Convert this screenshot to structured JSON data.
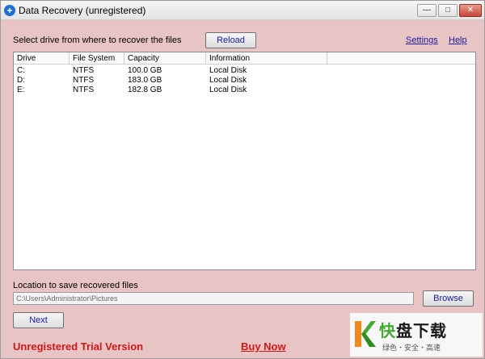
{
  "window": {
    "title": "Data Recovery (unregistered)",
    "controls": {
      "minimize": "—",
      "maximize": "□",
      "close": "✕"
    }
  },
  "toolbar": {
    "prompt": "Select drive from where to recover the files",
    "reload_label": "Reload",
    "settings_link": "Settings",
    "help_link": "Help"
  },
  "drives": {
    "columns": [
      "Drive",
      "File System",
      "Capacity",
      "Information"
    ],
    "rows": [
      [
        "C:",
        "NTFS",
        "100.0 GB",
        "Local Disk"
      ],
      [
        "D:",
        "NTFS",
        "183.0 GB",
        "Local Disk"
      ],
      [
        "E:",
        "NTFS",
        "182.8 GB",
        "Local Disk"
      ]
    ]
  },
  "location": {
    "label": "Location to save recovered files",
    "value": "C:\\Users\\Administrator\\Pictures",
    "browse_label": "Browse"
  },
  "footer": {
    "next_label": "Next",
    "trial_text": "Unregistered Trial Version",
    "buy_now_label": "Buy Now"
  },
  "watermark": {
    "title_green": "快",
    "title_rest": "盘下载",
    "subtitle": "绿色・安全・高速"
  },
  "colors": {
    "window_bg": "#e8c4c4",
    "link": "#1a1aa0",
    "trial_red": "#d01818",
    "brand_green": "#44a832",
    "brand_orange": "#f08a1e"
  }
}
